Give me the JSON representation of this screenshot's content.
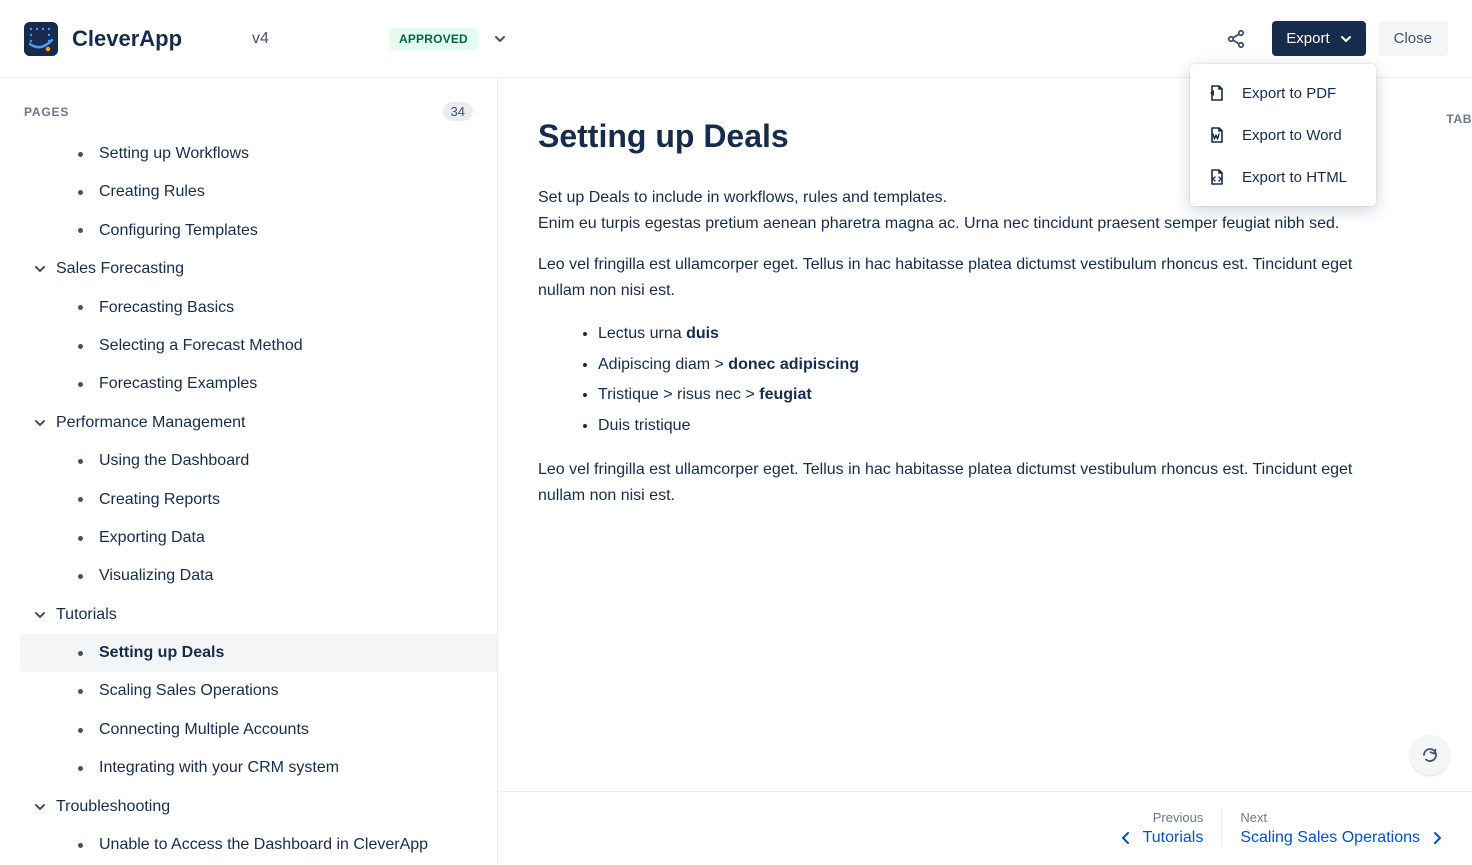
{
  "header": {
    "app_name": "CleverApp",
    "version": "v4",
    "status": "APPROVED",
    "export_label": "Export",
    "close_label": "Close"
  },
  "export_menu": {
    "items": [
      {
        "label": "Export to PDF"
      },
      {
        "label": "Export to Word"
      },
      {
        "label": "Export to HTML"
      }
    ]
  },
  "sidebar": {
    "title": "PAGES",
    "count": "34",
    "items": [
      {
        "type": "page",
        "level": 2,
        "label": "Setting up Workflows"
      },
      {
        "type": "page",
        "level": 2,
        "label": "Creating Rules"
      },
      {
        "type": "page",
        "level": 2,
        "label": "Configuring Templates"
      },
      {
        "type": "section",
        "label": "Sales Forecasting"
      },
      {
        "type": "page",
        "level": 2,
        "label": "Forecasting Basics"
      },
      {
        "type": "page",
        "level": 2,
        "label": "Selecting a Forecast Method"
      },
      {
        "type": "page",
        "level": 2,
        "label": "Forecasting Examples"
      },
      {
        "type": "section",
        "label": "Performance Management"
      },
      {
        "type": "page",
        "level": 2,
        "label": "Using the Dashboard"
      },
      {
        "type": "page",
        "level": 2,
        "label": "Creating Reports"
      },
      {
        "type": "page",
        "level": 2,
        "label": "Exporting Data"
      },
      {
        "type": "page",
        "level": 2,
        "label": "Visualizing Data"
      },
      {
        "type": "section",
        "label": "Tutorials"
      },
      {
        "type": "page",
        "level": 2,
        "label": "Setting up Deals",
        "active": true
      },
      {
        "type": "page",
        "level": 2,
        "label": "Scaling Sales Operations"
      },
      {
        "type": "page",
        "level": 2,
        "label": "Connecting Multiple Accounts"
      },
      {
        "type": "page",
        "level": 2,
        "label": "Integrating with your CRM system"
      },
      {
        "type": "section",
        "label": "Troubleshooting"
      },
      {
        "type": "page",
        "level": 2,
        "label": "Unable to Access the Dashboard in CleverApp"
      }
    ]
  },
  "content": {
    "title": "Setting up Deals",
    "toc_hint": "TAB",
    "p1_a": "Set up Deals to include in workflows, rules and templates.",
    "p1_b": "Enim eu turpis egestas pretium aenean pharetra magna ac. Urna nec tincidunt praesent semper feugiat nibh sed.",
    "p2": "Leo vel fringilla est ullamcorper eget. Tellus in hac habitasse platea dictumst vestibulum rhoncus est. Tincidunt eget nullam non nisi est.",
    "list": [
      {
        "pre": "Lectus urna ",
        "bold": "duis"
      },
      {
        "pre": "Adipiscing diam > ",
        "bold": "donec adipiscing"
      },
      {
        "pre": "Tristique > risus nec > ",
        "bold": "feugiat"
      },
      {
        "pre": "Duis tristique",
        "bold": ""
      }
    ],
    "p3": "Leo vel fringilla est ullamcorper eget. Tellus in hac habitasse platea dictumst vestibulum rhoncus est. Tincidunt eget nullam non nisi est."
  },
  "pager": {
    "prev_label": "Previous",
    "prev_link": "Tutorials",
    "next_label": "Next",
    "next_link": "Scaling Sales Operations"
  }
}
